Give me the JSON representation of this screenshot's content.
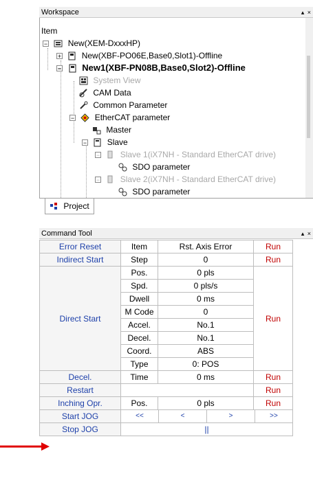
{
  "workspace": {
    "title": "Workspace",
    "controls": "▴ ×",
    "column_header": "Item",
    "tree": [
      {
        "label": "New(XEM-DxxxHP)",
        "icon": "project-root-icon",
        "style": "normal"
      },
      {
        "label": "New(XBF-PO06E,Base0,Slot1)-Offline",
        "icon": "module-icon",
        "style": "normal"
      },
      {
        "label": "New1(XBF-PN08B,Base0,Slot2)-Offline",
        "icon": "module-icon",
        "style": "bold"
      },
      {
        "label": "System View",
        "icon": "system-view-icon",
        "style": "dim"
      },
      {
        "label": "CAM Data",
        "icon": "cam-data-icon",
        "style": "normal"
      },
      {
        "label": "Common Parameter",
        "icon": "parameter-icon",
        "style": "normal"
      },
      {
        "label": "EtherCAT parameter",
        "icon": "ethercat-icon",
        "style": "normal"
      },
      {
        "label": "Master",
        "icon": "master-icon",
        "style": "normal"
      },
      {
        "label": "Slave",
        "icon": "slave-folder-icon",
        "style": "normal"
      },
      {
        "label": "Slave  1(iX7NH - Standard EtherCAT drive)",
        "icon": "drive-icon",
        "style": "dim"
      },
      {
        "label": "SDO parameter",
        "icon": "sdo-icon",
        "style": "normal"
      },
      {
        "label": "Slave  2(iX7NH - Standard EtherCAT drive)",
        "icon": "drive-icon",
        "style": "dim"
      },
      {
        "label": "SDO parameter",
        "icon": "sdo-icon",
        "style": "normal"
      }
    ],
    "tab": "Project"
  },
  "command_tool": {
    "title": "Command Tool",
    "controls": "▴ ×",
    "error_reset": {
      "label": "Error Reset",
      "field": "Item",
      "value": "Rst. Axis Error",
      "run": "Run"
    },
    "indirect_start": {
      "label": "Indirect Start",
      "field": "Step",
      "value": "0",
      "run": "Run"
    },
    "direct_start": {
      "label": "Direct Start",
      "run": "Run",
      "rows": [
        {
          "field": "Pos.",
          "value": "0 pls"
        },
        {
          "field": "Spd.",
          "value": "0 pls/s"
        },
        {
          "field": "Dwell",
          "value": "0 ms"
        },
        {
          "field": "M Code",
          "value": "0"
        },
        {
          "field": "Accel.",
          "value": "No.1"
        },
        {
          "field": "Decel.",
          "value": "No.1"
        },
        {
          "field": "Coord.",
          "value": "ABS"
        },
        {
          "field": "Type",
          "value": "0: POS"
        }
      ]
    },
    "decel": {
      "label": "Decel.",
      "field": "Time",
      "value": "0 ms",
      "run": "Run"
    },
    "restart": {
      "label": "Restart",
      "run": "Run"
    },
    "inching": {
      "label": "Inching Opr.",
      "field": "Pos.",
      "value": "0 pls",
      "run": "Run"
    },
    "start_jog": {
      "label": "Start JOG",
      "buttons": [
        "<<",
        "<",
        ">",
        ">>"
      ]
    },
    "stop_jog": {
      "label": "Stop JOG",
      "button": "||"
    }
  },
  "colors": {
    "label_blue": "#1c3fa9",
    "run_red": "#c00000",
    "arrow_red": "#e00000"
  }
}
